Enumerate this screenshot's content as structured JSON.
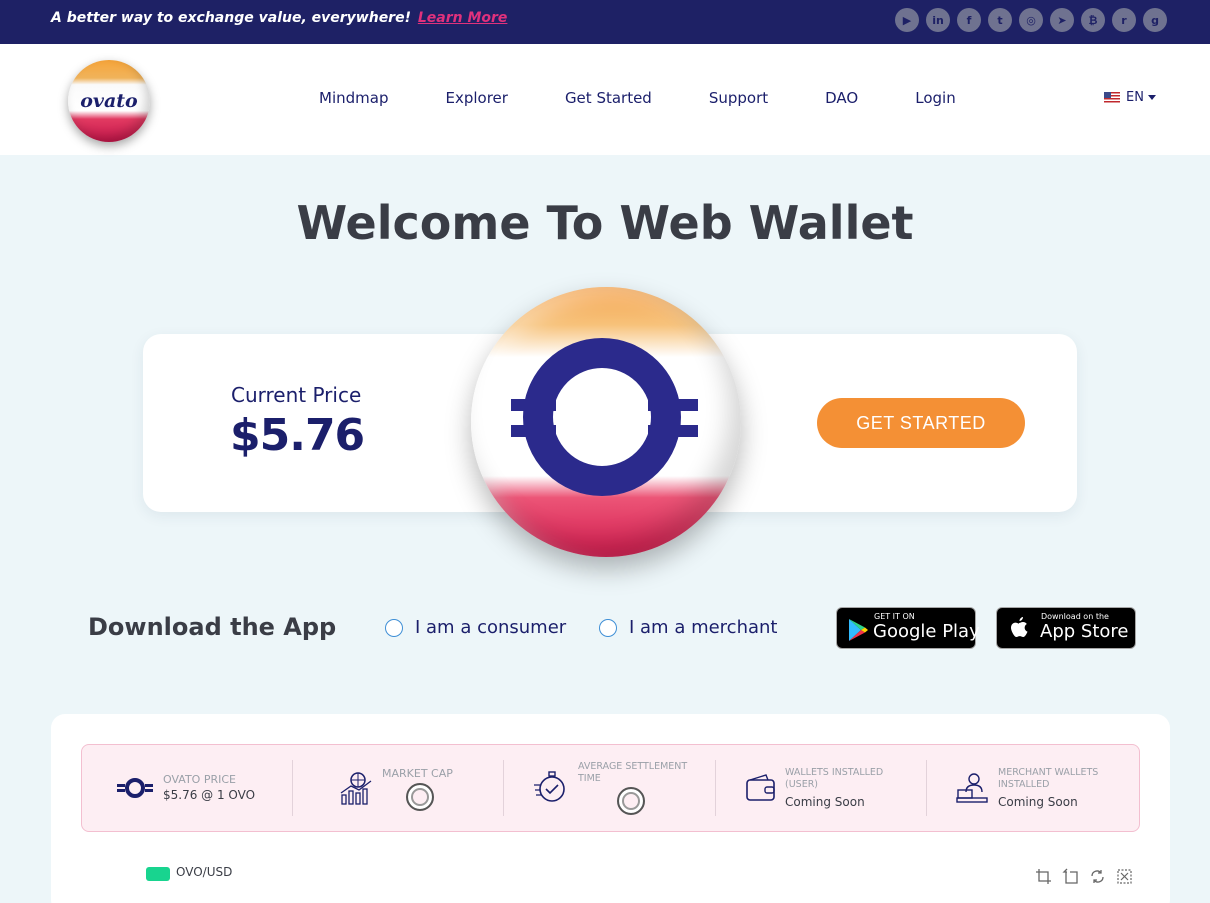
{
  "topbar": {
    "tagline": "A better way to exchange value, everywhere!",
    "learn_more": "Learn More",
    "socials": [
      {
        "icon": "youtube-icon",
        "glyph": "▶"
      },
      {
        "icon": "linkedin-icon",
        "glyph": "in"
      },
      {
        "icon": "facebook-icon",
        "glyph": "f"
      },
      {
        "icon": "twitter-icon",
        "glyph": "t"
      },
      {
        "icon": "instagram-icon",
        "glyph": "◎"
      },
      {
        "icon": "telegram-icon",
        "glyph": "➤"
      },
      {
        "icon": "bitcoin-icon",
        "glyph": "₿"
      },
      {
        "icon": "reddit-icon",
        "glyph": "r"
      },
      {
        "icon": "github-icon",
        "glyph": "g"
      }
    ]
  },
  "header": {
    "logo_text": "ovato",
    "nav": [
      "Mindmap",
      "Explorer",
      "Get Started",
      "Support",
      "DAO",
      "Login"
    ],
    "language": "EN"
  },
  "hero": {
    "title": "Welcome To Web Wallet",
    "price_label": "Current Price",
    "price_value": "$5.76",
    "cta": "GET STARTED"
  },
  "download": {
    "title": "Download the App",
    "options": [
      "I am a consumer",
      "I am a merchant"
    ],
    "google_small": "GET IT ON",
    "google_big": "Google Play",
    "apple_small": "Download on the",
    "apple_big": "App Store"
  },
  "stats": {
    "items": [
      {
        "label": "OVATO PRICE",
        "value": "$5.76 @ 1 OVO",
        "icon": "ovato-icon"
      },
      {
        "label": "MARKET CAP",
        "value": "",
        "icon": "chart-globe-icon"
      },
      {
        "label": "AVERAGE SETTLEMENT TIME",
        "value": "",
        "icon": "stopwatch-icon"
      },
      {
        "label": "WALLETS INSTALLED (USER)",
        "value": "Coming Soon",
        "icon": "wallet-icon"
      },
      {
        "label": "MERCHANT WALLETS INSTALLED",
        "value": "Coming Soon",
        "icon": "merchant-icon"
      }
    ]
  },
  "chart": {
    "legend": "OVO/USD",
    "legend_color": "#18d48f",
    "tools": [
      "crop-icon",
      "crop-alt-icon",
      "refresh-icon",
      "reset-zoom-icon"
    ]
  },
  "colors": {
    "navy": "#1e2165",
    "accent_orange": "#f49035",
    "link_pink": "#e0317c",
    "text_dark": "#3a3d46"
  }
}
